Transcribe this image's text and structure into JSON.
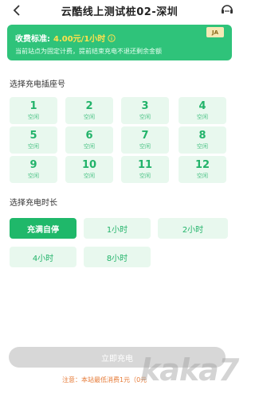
{
  "header": {
    "title": "云酷线上测试桩02-深圳"
  },
  "banner": {
    "fee_label": "收费标准:",
    "fee_value": "4.00元/1小时",
    "notice": "当前站点为固定计费，提前结束充电不退还剩余金额",
    "badge": "JA"
  },
  "sockets": {
    "title": "选择充电插座号",
    "items": [
      {
        "number": "1",
        "status": "空闲"
      },
      {
        "number": "2",
        "status": "空闲"
      },
      {
        "number": "3",
        "status": "空闲"
      },
      {
        "number": "4",
        "status": "空闲"
      },
      {
        "number": "5",
        "status": "空闲"
      },
      {
        "number": "6",
        "status": "空闲"
      },
      {
        "number": "7",
        "status": "空闲"
      },
      {
        "number": "8",
        "status": "空闲"
      },
      {
        "number": "9",
        "status": "空闲"
      },
      {
        "number": "10",
        "status": "空闲"
      },
      {
        "number": "11",
        "status": "空闲"
      },
      {
        "number": "12",
        "status": "空闲"
      }
    ]
  },
  "duration": {
    "title": "选择充电时长",
    "options": [
      "充满自停",
      "1小时",
      "2小时",
      "4小时",
      "8小时"
    ],
    "selected": "充满自停"
  },
  "footer": {
    "start_label": "立即充电",
    "note": "注意：本站最低消费1元（0元"
  },
  "watermark": "kaka7",
  "colors": {
    "accent": "#1fb86a",
    "banner": "#2fc37a",
    "note": "#e67a36"
  }
}
